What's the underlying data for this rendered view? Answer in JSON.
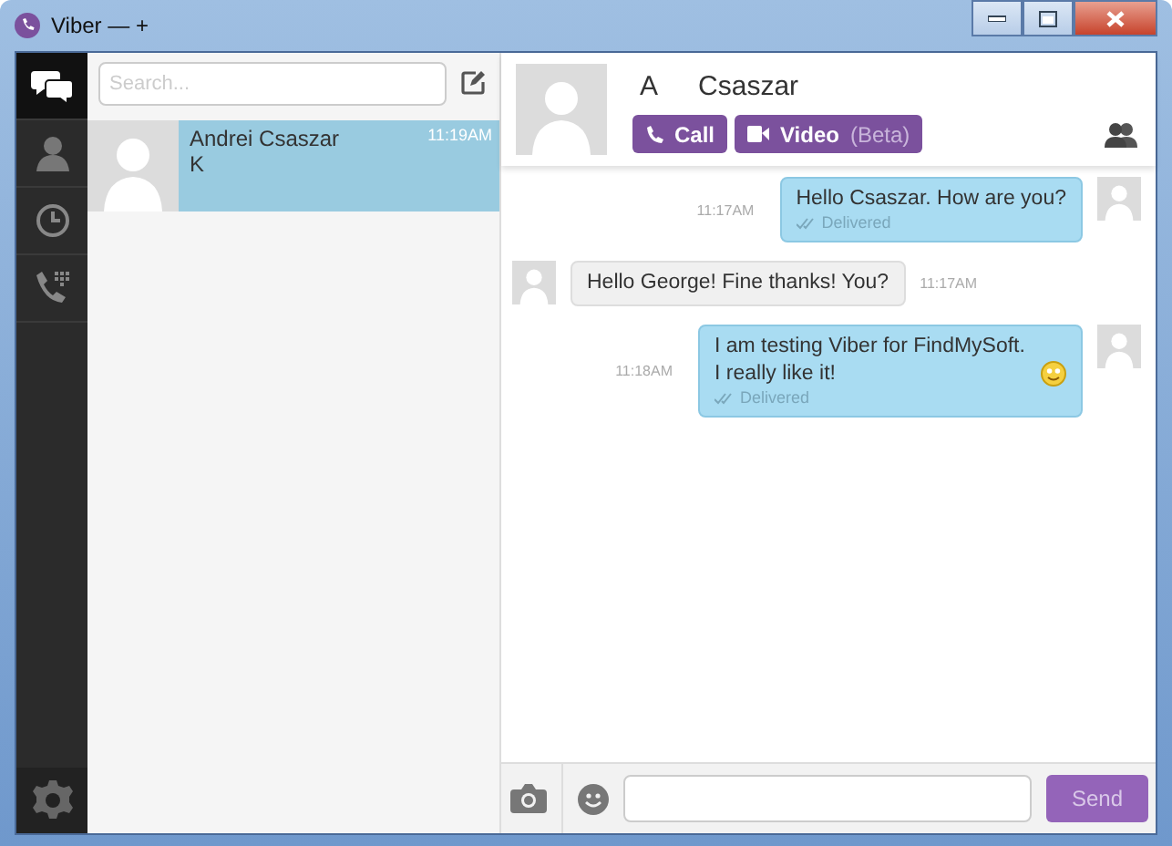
{
  "window": {
    "title": "Viber — +"
  },
  "nav": [
    {
      "kind": "chats",
      "selected": true
    },
    {
      "kind": "contacts",
      "selected": false
    },
    {
      "kind": "recents",
      "selected": false
    },
    {
      "kind": "dialpad",
      "selected": false
    }
  ],
  "search": {
    "placeholder": "Search..."
  },
  "conversations": [
    {
      "name": "Andrei Csaszar",
      "preview": "K",
      "time": "11:19AM",
      "selected": true
    }
  ],
  "chat": {
    "name_start": "A",
    "name_end": "Csaszar",
    "call_label": "Call",
    "video_label": "Video",
    "video_note": "(Beta)",
    "messages": [
      {
        "kind": "outgoing",
        "text": "Hello Csaszar. How are you?",
        "time": "11:17AM",
        "status": "Delivered",
        "emoji": false
      },
      {
        "kind": "incoming",
        "text": "Hello George! Fine thanks! You?",
        "time": "11:17AM",
        "emoji": false
      },
      {
        "kind": "outgoing",
        "text": "I am testing Viber for FindMySoft. I really like it!",
        "time": "11:18AM",
        "status": "Delivered",
        "emoji": true
      }
    ],
    "send_label": "Send"
  }
}
